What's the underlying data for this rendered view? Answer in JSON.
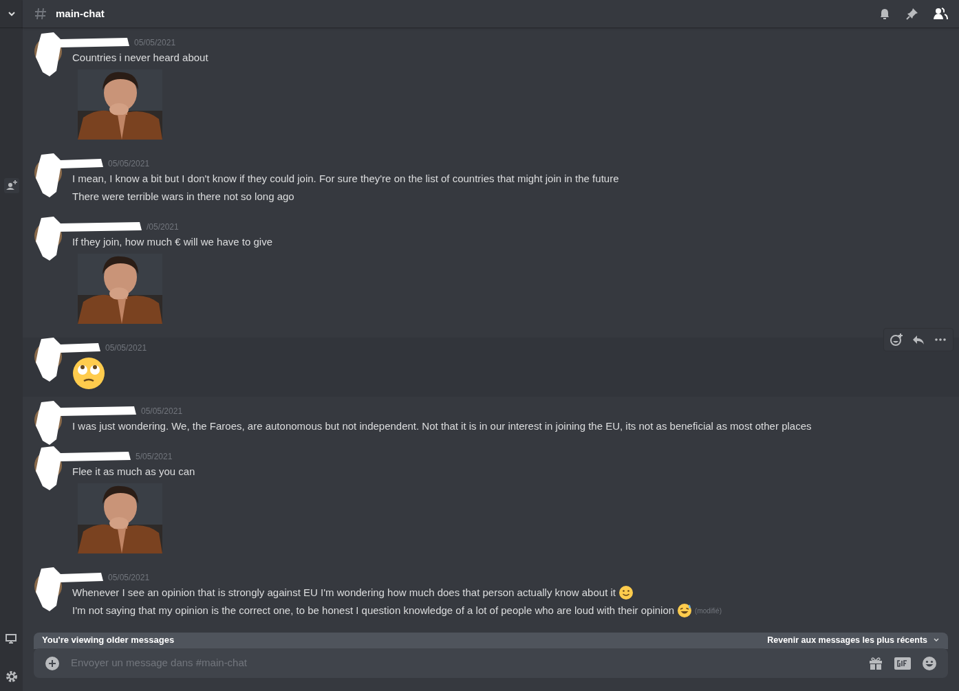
{
  "header": {
    "channel": "main-chat"
  },
  "messages": [
    {
      "date": "05/05/2021",
      "hovered": false,
      "lines": [
        {
          "text": "Countries i never heard about"
        }
      ],
      "attachments": [
        {
          "kind": "picture"
        }
      ]
    },
    {
      "date": "05/05/2021",
      "hovered": false,
      "lines": [
        {
          "text": "I mean, I know a bit but I don't know if they could join. For sure they're on the list of countries that might join in the future"
        },
        {
          "text": "There were terrible wars in there not so long ago"
        }
      ]
    },
    {
      "date": "/05/2021",
      "hovered": false,
      "lines": [
        {
          "text": "If they join, how much € will we have to give"
        }
      ],
      "attachments": [
        {
          "kind": "picture"
        }
      ]
    },
    {
      "date": "05/05/2021",
      "hovered": true,
      "big_emoji": {
        "kind": "rolling-eyes"
      }
    },
    {
      "date": "05/05/2021",
      "hovered": false,
      "lines": [
        {
          "text": "I was just wondering. We, the Faroes, are autonomous but not independent. Not that it is in our interest in joining the EU, its not as beneficial as most other places"
        }
      ]
    },
    {
      "date": "5/05/2021",
      "hovered": false,
      "lines": [
        {
          "text": "Flee it as much as you can"
        }
      ],
      "attachments": [
        {
          "kind": "picture"
        }
      ]
    },
    {
      "date": "05/05/2021",
      "hovered": false,
      "lines": [
        {
          "text": "Whenever I see an opinion that is strongly against EU I'm wondering how much does that person actually know about it",
          "emoji": {
            "kind": "smile"
          }
        },
        {
          "text": "I'm not saying that my opinion is the correct one, to be honest I question knowledge of a lot of people who are loud with their opinion",
          "emoji": {
            "kind": "sweat-smile"
          },
          "edited": "(modifié)"
        }
      ]
    }
  ],
  "banner": {
    "text": "You're viewing older messages",
    "action": "Revenir aux messages les plus récents"
  },
  "composer": {
    "placeholder": "Envoyer un message dans #main-chat"
  }
}
